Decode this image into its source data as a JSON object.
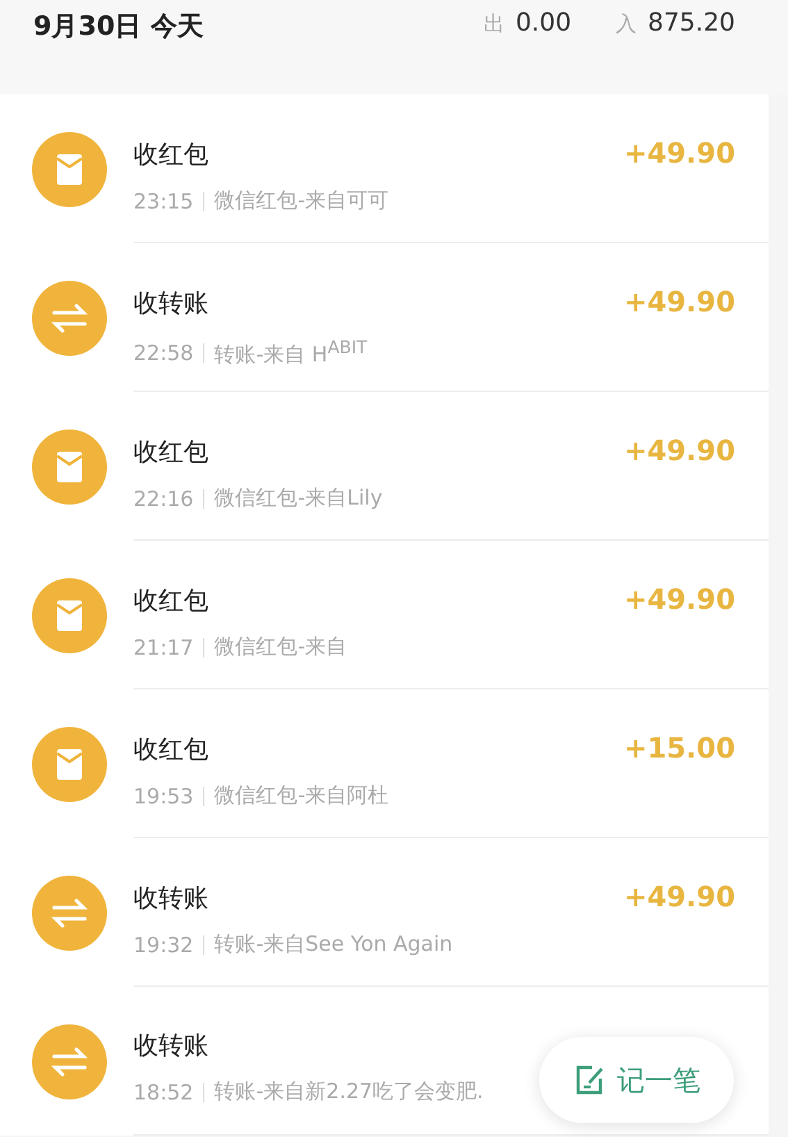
{
  "header": {
    "date": "9月30日 今天",
    "out_label": "出",
    "out_amount": "0.00",
    "in_label": "入",
    "in_amount": "875.20"
  },
  "records": [
    {
      "kind": "red_packet",
      "title": "收红包",
      "time": "23:15",
      "detail": "微信红包-来自可可",
      "amount": "+49.90"
    },
    {
      "kind": "transfer",
      "title": "收转账",
      "time": "22:58",
      "detail": "转账-来自 H$^{ABIT}$",
      "amount": "+49.90"
    },
    {
      "kind": "red_packet",
      "title": "收红包",
      "time": "22:16",
      "detail": "微信红包-来自Lily",
      "amount": "+49.90"
    },
    {
      "kind": "red_packet",
      "title": "收红包",
      "time": "21:17",
      "detail": "微信红包-来自",
      "amount": "+49.90"
    },
    {
      "kind": "red_packet",
      "title": "收红包",
      "time": "19:53",
      "detail": "微信红包-来自阿杜",
      "amount": "+15.00"
    },
    {
      "kind": "transfer",
      "title": "收转账",
      "time": "19:32",
      "detail": "转账-来自See Yon Again",
      "amount": "+49.90"
    },
    {
      "kind": "transfer",
      "title": "收转账",
      "time": "18:52",
      "detail": "转账-来自新2.27吃了会变肥."
    }
  ],
  "fab": {
    "label": "记一笔"
  }
}
